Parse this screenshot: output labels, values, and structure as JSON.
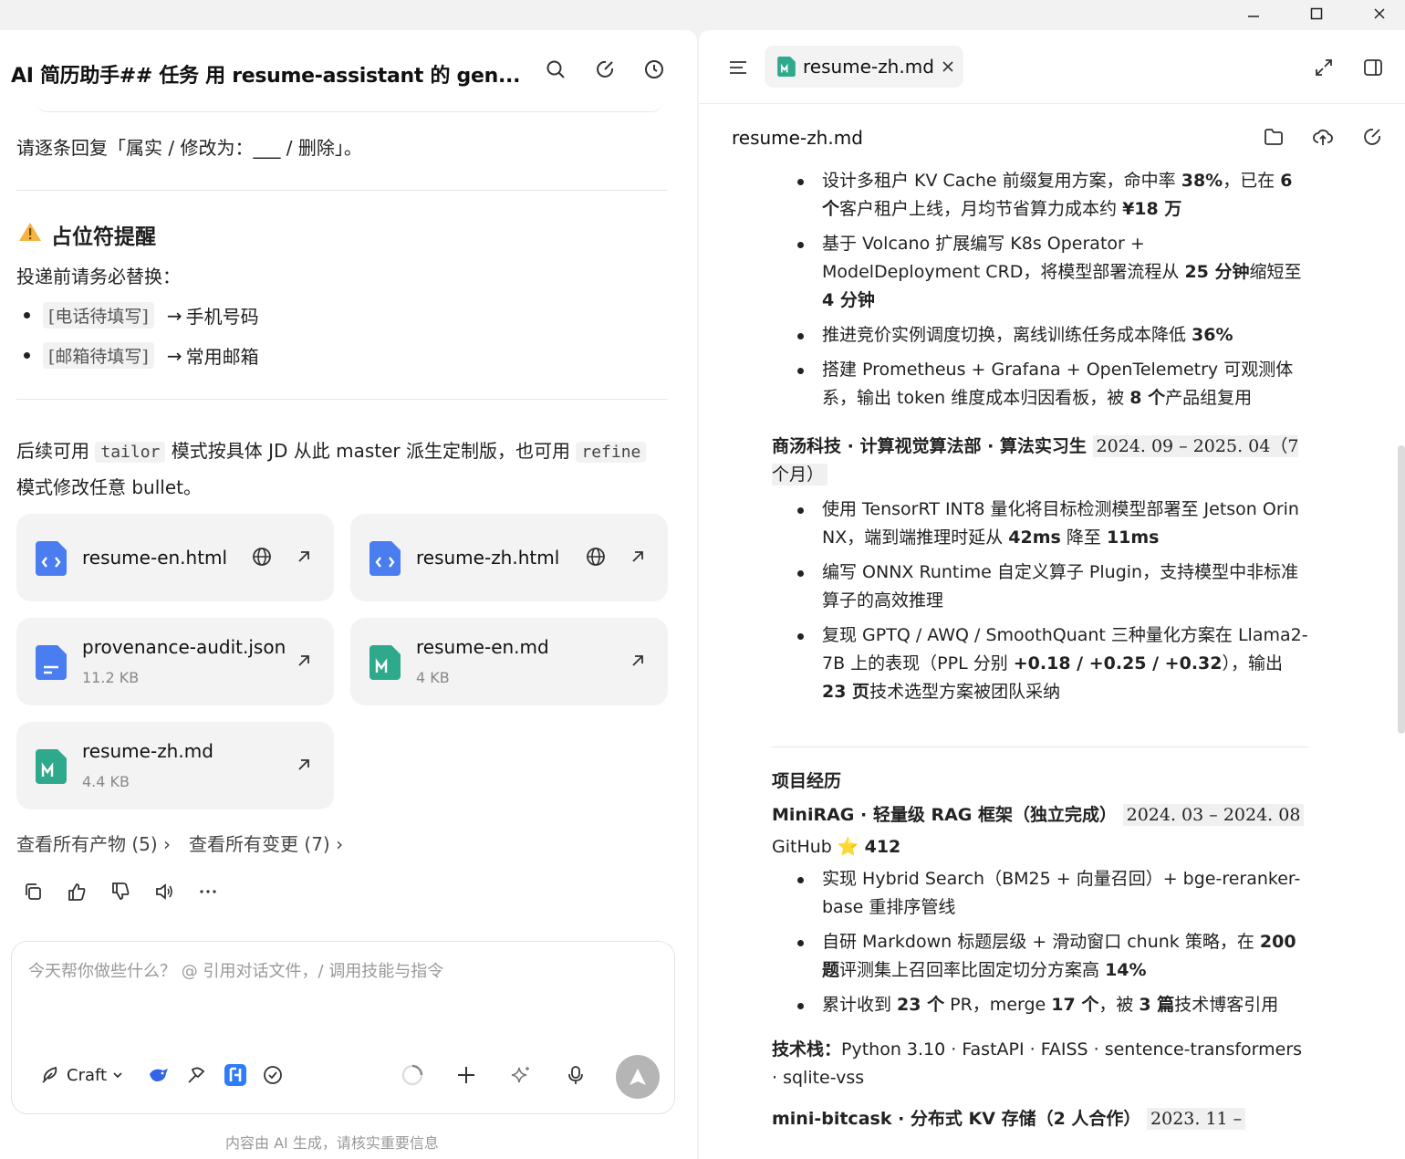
{
  "window": {
    "minimize": "—",
    "maximize": "☐",
    "close": "✕"
  },
  "chat": {
    "title": "AI 简历助手## 任务 用 resume-assistant 的 gen...",
    "line1": "请逐条回复「属实 / 修改为：___ / 删除」。",
    "section_title": "占位符提醒",
    "section_icon": "⚠",
    "section_intro": "投递前请务必替换：",
    "placeholders": [
      {
        "code": "[电话待填写]",
        "arrow": "→",
        "text": "手机号码"
      },
      {
        "code": "[邮箱待填写]",
        "arrow": "→",
        "text": "常用邮箱"
      }
    ],
    "tail_p1": "后续可用",
    "tail_code1": "tailor",
    "tail_p2": "模式按具体 JD 从此 master 派生定制版，也可用",
    "tail_code2": "refine",
    "tail_p3": "模式修改任意 bullet。",
    "files": [
      {
        "name": "resume-en.html",
        "size": ""
      },
      {
        "name": "resume-zh.html",
        "size": ""
      },
      {
        "name": "provenance-audit.json",
        "size": "11.2 KB"
      },
      {
        "name": "resume-en.md",
        "size": "4 KB"
      },
      {
        "name": "resume-zh.md",
        "size": "4.4 KB"
      }
    ],
    "link_artifacts": "查看所有产物 (5)",
    "link_changes": "查看所有变更 (7)",
    "input_placeholder": "今天帮你做些什么？ @ 引用对话文件，/ 调用技能与指令",
    "mode_label": "Craft",
    "disclaimer": "内容由 AI 生成，请核实重要信息"
  },
  "doc": {
    "tab_label": "resume-zh.md",
    "title": "resume-zh.md",
    "block1": [
      [
        "设计多租户 KV Cache 前缀复用方案，命中率 ",
        "38%",
        "，已在 ",
        "6 个",
        "客户租户上线，月均节省算力成本约 ",
        "¥18 万",
        ""
      ],
      [
        "基于 Volcano 扩展编写 K8s Operator + ModelDeployment CRD，将模型部署流程从 ",
        "25 分钟",
        "缩短至 ",
        "4 分钟",
        "",
        "",
        ""
      ],
      [
        "推进竞价实例调度切换，离线训练任务成本降低 ",
        "36%",
        "",
        "",
        "",
        "",
        ""
      ],
      [
        "搭建 Prometheus + Grafana + OpenTelemetry 可观测体系，输出 token 维度成本归因看板，被 ",
        "8 个",
        "产品组复用",
        "",
        "",
        "",
        ""
      ]
    ],
    "role2_title": "商汤科技 · 计算视觉算法部 · 算法实习生",
    "role2_period": "2024. 09 – 2025. 04（7 个月）",
    "block2": [
      [
        "使用 TensorRT INT8 量化将目标检测模型部署至 Jetson Orin NX，端到端推理时延从 ",
        "42ms",
        " 降至 ",
        "11ms",
        "",
        "",
        ""
      ],
      [
        "编写 ONNX Runtime 自定义算子 Plugin，支持模型中非标准算子的高效推理",
        "",
        "",
        "",
        "",
        "",
        ""
      ],
      [
        "复现 GPTQ / AWQ / SmoothQuant 三种量化方案在 Llama2-7B 上的表现（PPL 分别 ",
        "+0.18 / +0.25 / +0.32",
        "），输出 ",
        "23 页",
        "技术选型方案被团队采纳",
        "",
        ""
      ]
    ],
    "projects_heading": "项目经历",
    "proj1_title": "MiniRAG · 轻量级 RAG 框架（独立完成）",
    "proj1_period": "2024. 03 – 2024. 08",
    "proj1_github": "GitHub",
    "proj1_star": "⭐",
    "proj1_stars": "412",
    "block3": [
      [
        "实现 Hybrid Search（BM25 + 向量召回）+ bge-reranker-base 重排序管线",
        "",
        "",
        "",
        "",
        "",
        ""
      ],
      [
        "自研 Markdown 标题层级 + 滑动窗口 chunk 策略，在 ",
        "200 题",
        "评测集上召回率比固定切分方案高 ",
        "14%",
        "",
        "",
        ""
      ],
      [
        "累计收到 ",
        "23 个",
        " PR，merge ",
        "17 个",
        "，被 ",
        "3 篇",
        "技术博客引用"
      ]
    ],
    "stack_label": "技术栈：",
    "stack_value": "Python 3.10 · FastAPI · FAISS · sentence-transformers · sqlite-vss",
    "proj2_title": "mini-bitcask · 分布式 KV 存储（2 人合作）",
    "proj2_period": "2023. 11 –"
  }
}
